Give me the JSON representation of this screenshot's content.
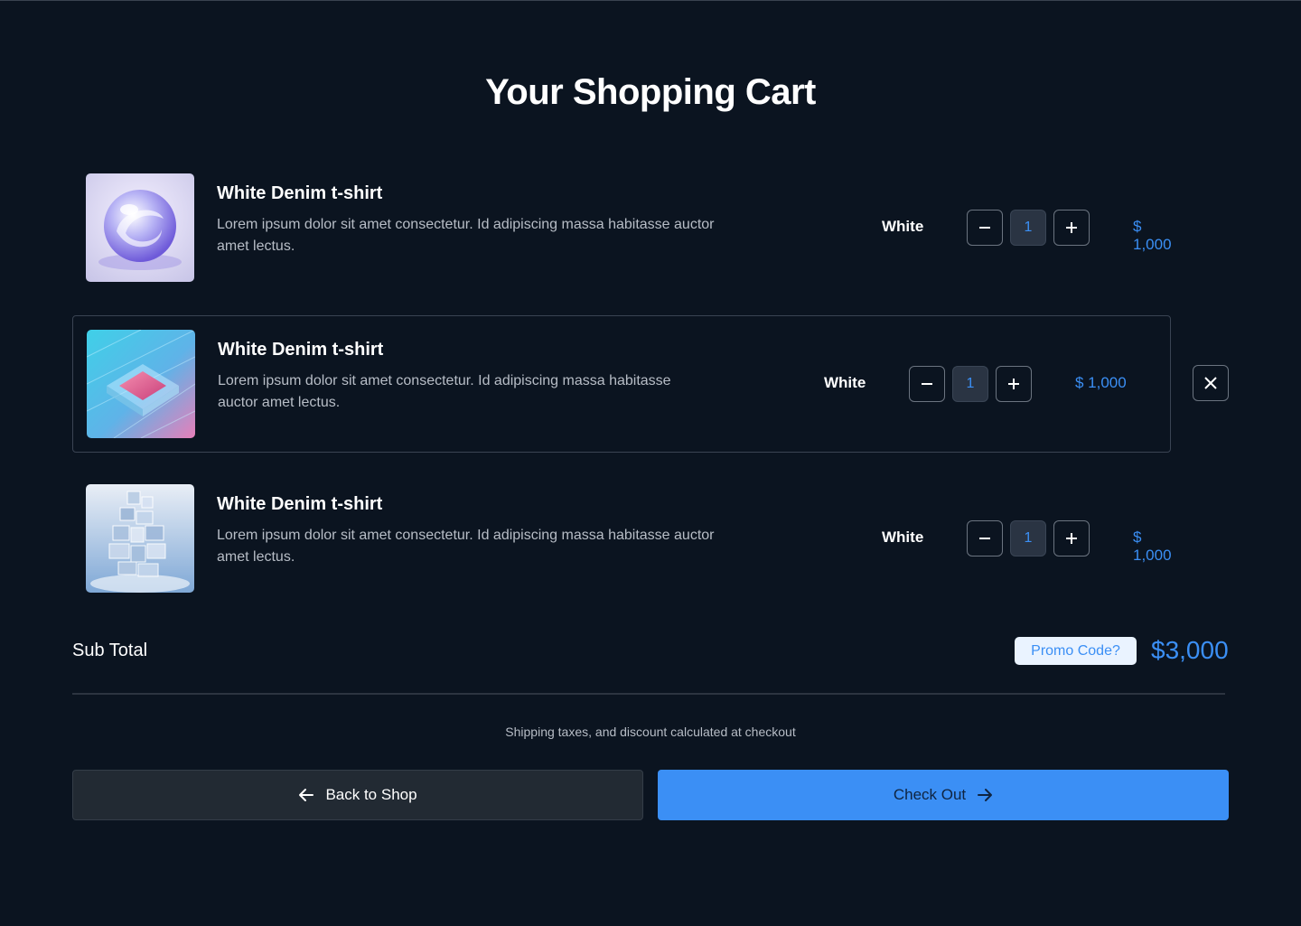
{
  "page": {
    "title": "Your Shopping Cart"
  },
  "cart": {
    "items": [
      {
        "name": "White Denim t-shirt",
        "description_line1": "Lorem ipsum dolor sit amet consectetur. Id adipiscing massa habitasse auctor",
        "description_line2": "amet lectus.",
        "color": "White",
        "quantity": "1",
        "price": "$ 1,000",
        "image_icon": "glass-sphere-image"
      },
      {
        "name": "White Denim t-shirt",
        "description_line1": "Lorem ipsum dolor sit amet consectetur. Id adipiscing massa habitasse",
        "description_line2": "auctor amet lectus.",
        "color": "White",
        "quantity": "1",
        "price": "$ 1,000",
        "image_icon": "glass-chip-image",
        "highlighted": true
      },
      {
        "name": "White Denim t-shirt",
        "description_line1": "Lorem ipsum dolor sit amet consectetur. Id adipiscing massa habitasse auctor",
        "description_line2": "amet lectus.",
        "color": "White",
        "quantity": "1",
        "price": "$ 1,000",
        "image_icon": "glass-cubes-image"
      }
    ]
  },
  "summary": {
    "subtotal_label": "Sub Total",
    "promo_label": "Promo Code?",
    "subtotal_value": "$3,000",
    "shipping_note": "Shipping taxes, and discount calculated at checkout"
  },
  "actions": {
    "back_label": "Back to Shop",
    "checkout_label": "Check Out"
  },
  "colors": {
    "background": "#0b1420",
    "accent": "#3b8ff5",
    "promo_bg": "#eaf3ff",
    "secondary_button": "#222a33"
  }
}
